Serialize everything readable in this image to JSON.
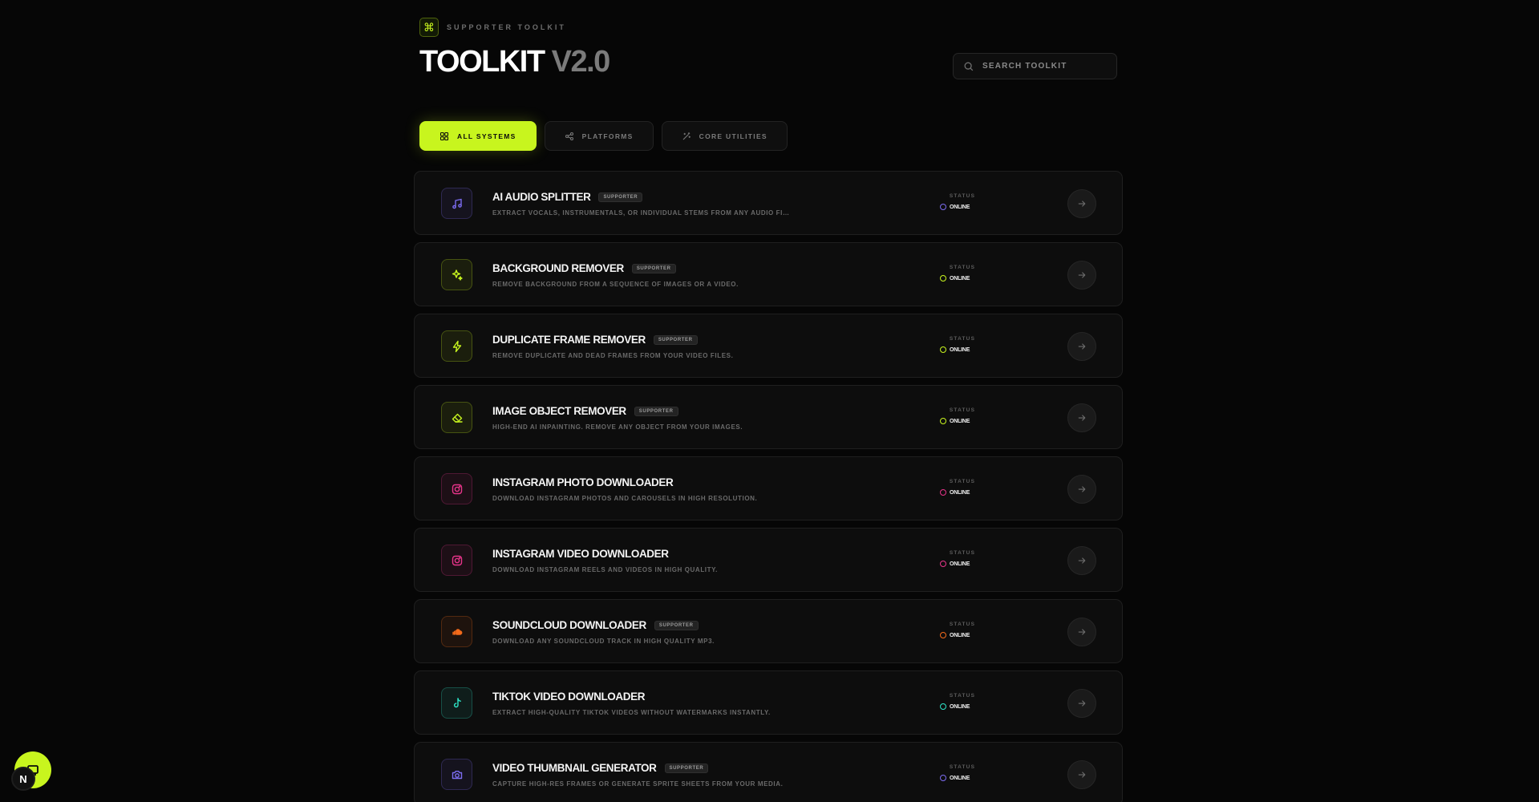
{
  "header": {
    "eyebrow": "SUPPORTER TOOLKIT",
    "logo_icon": "command-icon",
    "title_main": "TOOLKIT",
    "title_version": "V2.0"
  },
  "search": {
    "placeholder": "SEARCH TOOLKIT",
    "icon": "search-icon"
  },
  "filters": [
    {
      "label": "ALL SYSTEMS",
      "icon": "grid-icon",
      "active": true
    },
    {
      "label": "PLATFORMS",
      "icon": "share-icon",
      "active": false
    },
    {
      "label": "CORE UTILITIES",
      "icon": "wand-icon",
      "active": false
    }
  ],
  "status_label": "STATUS",
  "tools": [
    {
      "name": "AI AUDIO SPLITTER",
      "badge": "SUPPORTER",
      "desc": "EXTRACT VOCALS, INSTRUMENTALS, OR INDIVIDUAL STEMS FROM ANY AUDIO FI...",
      "status": "ONLINE",
      "icon": "music-note-icon",
      "color": "#7c6cf0"
    },
    {
      "name": "BACKGROUND REMOVER",
      "badge": "SUPPORTER",
      "desc": "REMOVE BACKGROUND FROM A SEQUENCE OF IMAGES OR A VIDEO.",
      "status": "ONLINE",
      "icon": "sparkles-icon",
      "color": "#c8f51e"
    },
    {
      "name": "DUPLICATE FRAME REMOVER",
      "badge": "SUPPORTER",
      "desc": "REMOVE DUPLICATE AND DEAD FRAMES FROM YOUR VIDEO FILES.",
      "status": "ONLINE",
      "icon": "lightning-icon",
      "color": "#c8f51e"
    },
    {
      "name": "IMAGE OBJECT REMOVER",
      "badge": "SUPPORTER",
      "desc": "HIGH-END AI INPAINTING. REMOVE ANY OBJECT FROM YOUR IMAGES.",
      "status": "ONLINE",
      "icon": "eraser-icon",
      "color": "#c8f51e"
    },
    {
      "name": "INSTAGRAM PHOTO DOWNLOADER",
      "badge": "",
      "desc": "DOWNLOAD INSTAGRAM PHOTOS AND CAROUSELS IN HIGH RESOLUTION.",
      "status": "ONLINE",
      "icon": "instagram-icon",
      "color": "#e8348a"
    },
    {
      "name": "INSTAGRAM VIDEO DOWNLOADER",
      "badge": "",
      "desc": "DOWNLOAD INSTAGRAM REELS AND VIDEOS IN HIGH QUALITY.",
      "status": "ONLINE",
      "icon": "instagram-icon",
      "color": "#e8348a"
    },
    {
      "name": "SOUNDCLOUD DOWNLOADER",
      "badge": "SUPPORTER",
      "desc": "DOWNLOAD ANY SOUNDCLOUD TRACK IN HIGH QUALITY MP3.",
      "status": "ONLINE",
      "icon": "soundcloud-icon",
      "color": "#f26a1b"
    },
    {
      "name": "TIKTOK VIDEO DOWNLOADER",
      "badge": "",
      "desc": "EXTRACT HIGH-QUALITY TIKTOK VIDEOS WITHOUT WATERMARKS INSTANTLY.",
      "status": "ONLINE",
      "icon": "tiktok-icon",
      "color": "#2ee6c8"
    },
    {
      "name": "VIDEO THUMBNAIL GENERATOR",
      "badge": "SUPPORTER",
      "desc": "CAPTURE HIGH-RES FRAMES OR GENERATE SPRITE SHEETS FROM YOUR MEDIA.",
      "status": "ONLINE",
      "icon": "camera-icon",
      "color": "#7c6cf0"
    }
  ],
  "corner": {
    "badge_letter": "N",
    "fab_icon": "screen-icon"
  }
}
